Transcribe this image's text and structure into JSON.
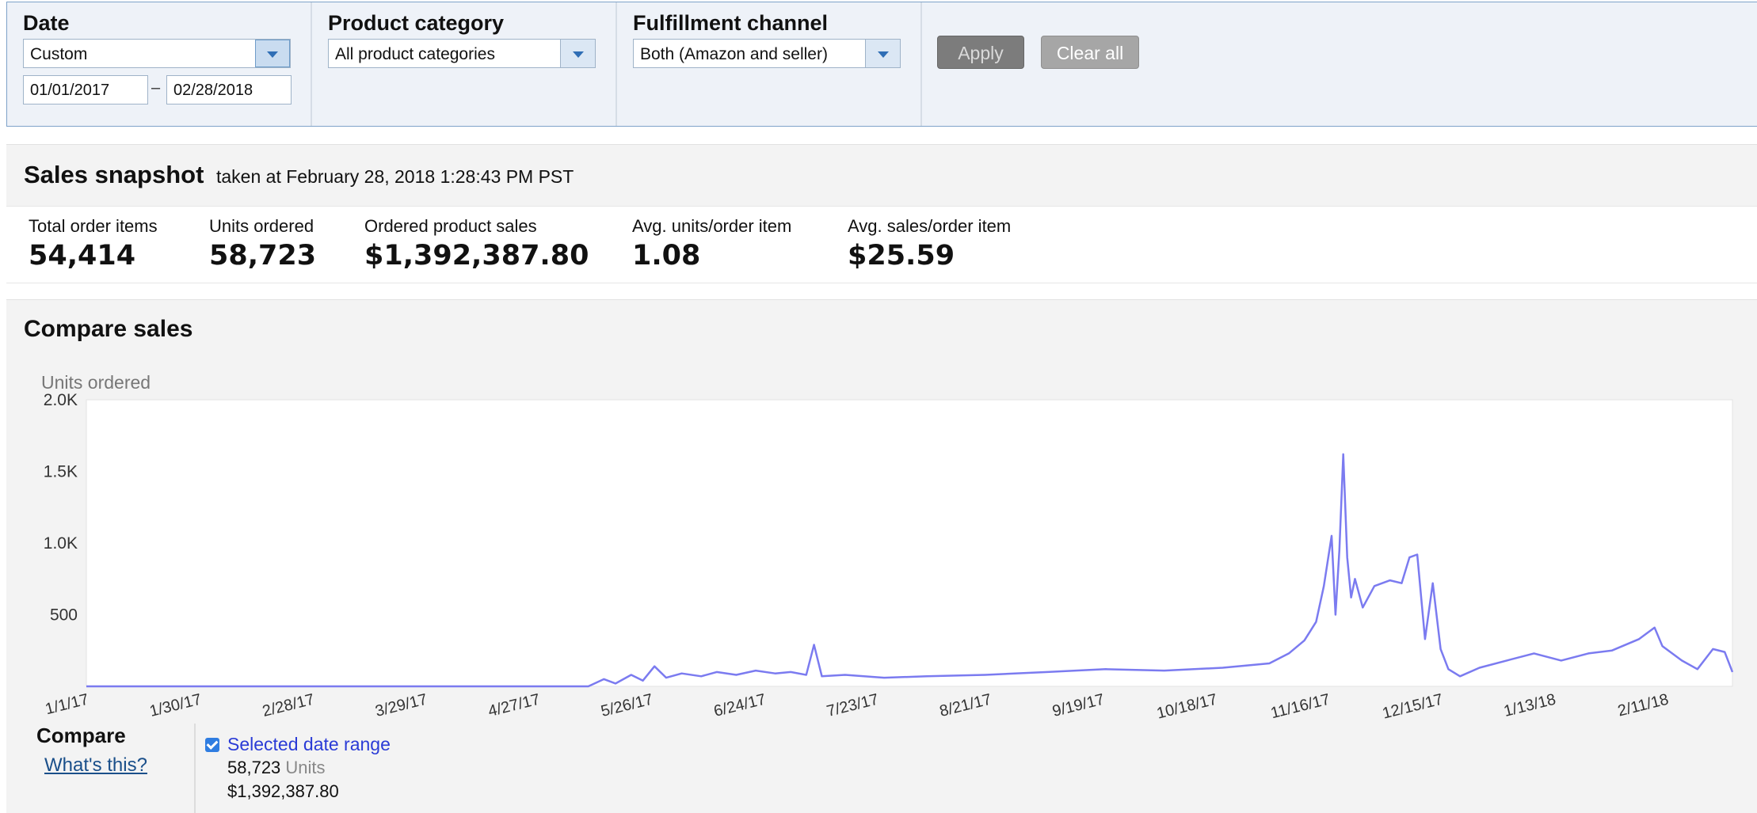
{
  "filters": {
    "date": {
      "label": "Date",
      "preset": "Custom",
      "start": "01/01/2017",
      "end": "02/28/2018",
      "separator": "–"
    },
    "product_category": {
      "label": "Product category",
      "value": "All product categories"
    },
    "fulfillment_channel": {
      "label": "Fulfillment channel",
      "value": "Both (Amazon and seller)"
    },
    "apply_label": "Apply",
    "clear_label": "Clear all"
  },
  "snapshot": {
    "title": "Sales snapshot",
    "taken": "taken at February 28, 2018 1:28:43 PM PST",
    "metrics": [
      {
        "label": "Total order items",
        "value": "54,414"
      },
      {
        "label": "Units ordered",
        "value": "58,723"
      },
      {
        "label": "Ordered product sales",
        "value": "$1,392,387.80"
      },
      {
        "label": "Avg. units/order item",
        "value": "1.08"
      },
      {
        "label": "Avg. sales/order item",
        "value": "$25.59"
      }
    ]
  },
  "compare": {
    "title": "Compare sales",
    "compare_label": "Compare",
    "whats_this": "What's this?",
    "series_label": "Selected date range",
    "units_value": "58,723",
    "units_label": "Units",
    "sales_value": "$1,392,387.80"
  },
  "colors": {
    "line": "#7b7bf0",
    "accent": "#2a3bd6"
  },
  "chart_data": {
    "type": "line",
    "ylabel": "Units ordered",
    "xlabel": "",
    "ylim": [
      0,
      2000
    ],
    "y_ticks": [
      500,
      1000,
      1500,
      2000
    ],
    "y_tick_labels": [
      "500",
      "1.0K",
      "1.5K",
      "2.0K"
    ],
    "x_range": [
      "2017-01-01",
      "2018-02-28"
    ],
    "x_ticks": [
      "2017-01-01",
      "2017-01-30",
      "2017-02-28",
      "2017-03-29",
      "2017-04-27",
      "2017-05-26",
      "2017-06-24",
      "2017-07-23",
      "2017-08-21",
      "2017-09-19",
      "2017-10-18",
      "2017-11-16",
      "2017-12-15",
      "2018-01-13",
      "2018-02-11"
    ],
    "x_tick_labels": [
      "1/1/17",
      "1/30/17",
      "2/28/17",
      "3/29/17",
      "4/27/17",
      "5/26/17",
      "6/24/17",
      "7/23/17",
      "8/21/17",
      "9/19/17",
      "10/18/17",
      "11/16/17",
      "12/15/17",
      "1/13/18",
      "2/11/18"
    ],
    "series": [
      {
        "points": [
          [
            "2017-01-01",
            0
          ],
          [
            "2017-05-10",
            0
          ],
          [
            "2017-05-14",
            50
          ],
          [
            "2017-05-17",
            20
          ],
          [
            "2017-05-21",
            80
          ],
          [
            "2017-05-24",
            40
          ],
          [
            "2017-05-27",
            140
          ],
          [
            "2017-05-30",
            60
          ],
          [
            "2017-06-03",
            90
          ],
          [
            "2017-06-08",
            70
          ],
          [
            "2017-06-12",
            100
          ],
          [
            "2017-06-17",
            80
          ],
          [
            "2017-06-22",
            110
          ],
          [
            "2017-06-27",
            90
          ],
          [
            "2017-07-01",
            100
          ],
          [
            "2017-07-05",
            80
          ],
          [
            "2017-07-07",
            290
          ],
          [
            "2017-07-09",
            70
          ],
          [
            "2017-07-15",
            80
          ],
          [
            "2017-07-25",
            60
          ],
          [
            "2017-08-05",
            70
          ],
          [
            "2017-08-20",
            80
          ],
          [
            "2017-09-05",
            100
          ],
          [
            "2017-09-20",
            120
          ],
          [
            "2017-10-05",
            110
          ],
          [
            "2017-10-20",
            130
          ],
          [
            "2017-11-01",
            160
          ],
          [
            "2017-11-06",
            230
          ],
          [
            "2017-11-10",
            320
          ],
          [
            "2017-11-13",
            450
          ],
          [
            "2017-11-15",
            700
          ],
          [
            "2017-11-17",
            1050
          ],
          [
            "2017-11-18",
            500
          ],
          [
            "2017-11-19",
            950
          ],
          [
            "2017-11-20",
            1620
          ],
          [
            "2017-11-21",
            900
          ],
          [
            "2017-11-22",
            620
          ],
          [
            "2017-11-23",
            750
          ],
          [
            "2017-11-25",
            550
          ],
          [
            "2017-11-28",
            700
          ],
          [
            "2017-12-02",
            740
          ],
          [
            "2017-12-05",
            720
          ],
          [
            "2017-12-07",
            900
          ],
          [
            "2017-12-09",
            920
          ],
          [
            "2017-12-11",
            330
          ],
          [
            "2017-12-13",
            720
          ],
          [
            "2017-12-15",
            260
          ],
          [
            "2017-12-17",
            120
          ],
          [
            "2017-12-20",
            70
          ],
          [
            "2017-12-25",
            130
          ],
          [
            "2018-01-01",
            180
          ],
          [
            "2018-01-08",
            230
          ],
          [
            "2018-01-15",
            180
          ],
          [
            "2018-01-22",
            230
          ],
          [
            "2018-01-28",
            250
          ],
          [
            "2018-02-04",
            330
          ],
          [
            "2018-02-08",
            410
          ],
          [
            "2018-02-10",
            280
          ],
          [
            "2018-02-15",
            180
          ],
          [
            "2018-02-19",
            120
          ],
          [
            "2018-02-23",
            260
          ],
          [
            "2018-02-26",
            240
          ],
          [
            "2018-02-28",
            100
          ]
        ]
      }
    ]
  }
}
